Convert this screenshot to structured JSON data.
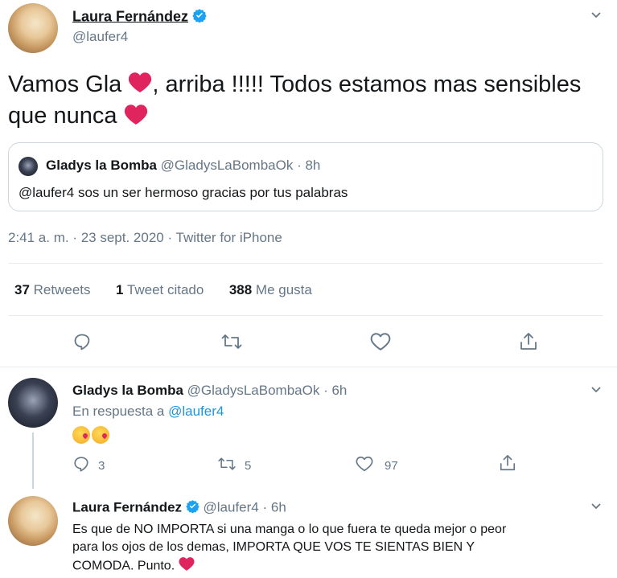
{
  "main_tweet": {
    "author_name": "Laura Fernández",
    "author_handle": "@laufer4",
    "text_part1": "Vamos Gla",
    "text_part2": ", arriba !!!!! Todos estamos mas sensibles",
    "text_part3": "que nunca",
    "quoted": {
      "author_name": "Gladys la Bomba",
      "author_handle": "@GladysLaBombaOk",
      "time": "· 8h",
      "text": "@laufer4 sos un ser hermoso gracias por tus palabras"
    },
    "meta": "2:41 a. m. · 23 sept. 2020 · Twitter for iPhone",
    "stats": {
      "retweets_count": "37",
      "retweets_label": "Retweets",
      "quotes_count": "1",
      "quotes_label": "Tweet citado",
      "likes_count": "388",
      "likes_label": "Me gusta"
    }
  },
  "reply1": {
    "author_name": "Gladys la Bomba",
    "author_handle": "@GladysLaBombaOk",
    "time": "· 6h",
    "reply_prefix": "En respuesta a",
    "reply_to": "@laufer4",
    "reply_count": "3",
    "retweet_count": "5",
    "like_count": "97"
  },
  "reply2": {
    "author_name": "Laura Fernández",
    "author_handle": "@laufer4",
    "time": "· 6h",
    "line1": "Es que de NO IMPORTA si una manga o lo que fuera te queda mejor o peor",
    "line2": "para los ojos de los demas, IMPORTA QUE VOS TE SIENTAS BIEN Y",
    "line3": "COMODA. Punto."
  },
  "colors": {
    "verified": "#1da1f2",
    "heart": "#e0245e",
    "link": "#1b95e0",
    "muted": "#657786"
  },
  "icons": [
    "verified-badge-icon",
    "chevron-down-icon",
    "heart-emoji-icon",
    "reply-icon",
    "retweet-icon",
    "like-icon",
    "share-icon",
    "kiss-emoji-icon"
  ]
}
